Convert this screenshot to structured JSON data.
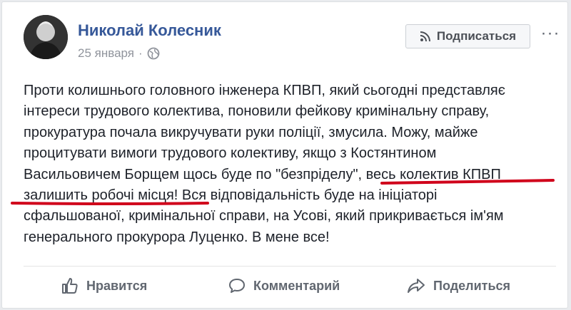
{
  "post": {
    "author": "Николай Колесник",
    "date": "25 января",
    "subscribe_label": "Подписаться",
    "more_label": "···",
    "lines": [
      "Проти колишнього головного інженера КПВП, який сьогодні представляє",
      "інтереси трудового колективa, поновили фейкову кримінальну справу,",
      "прокуратура почала викручувати руки поліції, змусила. Можу, майже",
      "процитувати вимоги трудового колективу, якщо з Костянтином",
      "Васильовичем Борщем щось буде по \"безпріделу\", весь колектив КПВП",
      "залишить робочі місця! Вся відповідальність буде на ініціаторі",
      "сфальшованої, кримінальної справи, на Усові, який прикривається ім'ям",
      "генерального прокурора Луценко. В мене все!"
    ]
  },
  "actions": {
    "like": "Нравится",
    "comment": "Комментарий",
    "share": "Поделиться"
  },
  "colors": {
    "author": "#365899",
    "underline": "#d0021b",
    "muted": "#90949c"
  },
  "icons": {
    "globe": "globe-icon",
    "rss": "rss-icon",
    "like": "thumbs-up-icon",
    "comment": "comment-icon",
    "share": "share-arrow-icon"
  }
}
